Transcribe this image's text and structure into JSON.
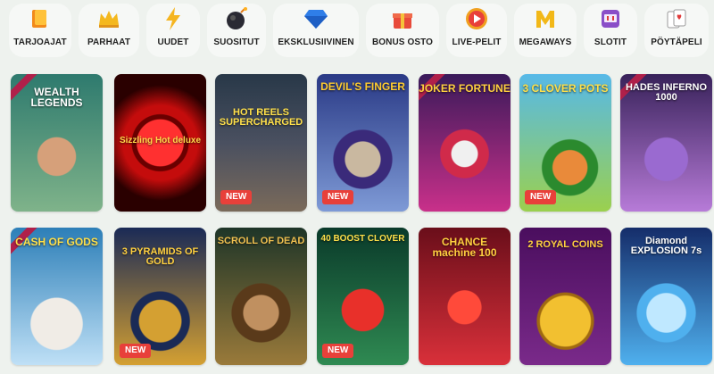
{
  "categories": [
    {
      "label": "TARJOAJAT",
      "icon": "book-icon"
    },
    {
      "label": "PARHAAT",
      "icon": "crown-icon"
    },
    {
      "label": "UUDET",
      "icon": "lightning-icon"
    },
    {
      "label": "SUOSITUT",
      "icon": "bomb-icon"
    },
    {
      "label": "EKSKLUSIIVINEN",
      "icon": "gem-icon"
    },
    {
      "label": "BONUS OSTO",
      "icon": "gift-icon"
    },
    {
      "label": "LIVE-PELIT",
      "icon": "play-icon"
    },
    {
      "label": "MEGAWAYS",
      "icon": "megaways-m-icon"
    },
    {
      "label": "SLOTIT",
      "icon": "slot-machine-icon"
    },
    {
      "label": "PÖYTÄPELI",
      "icon": "cards-icon"
    }
  ],
  "badges": {
    "new": "NEW"
  },
  "games": [
    {
      "title": "WEALTH LEGENDS",
      "new": false,
      "colors": [
        "#2e7a6e",
        "#7fb38a"
      ]
    },
    {
      "title": "Sizzling Hot deluxe",
      "new": false,
      "colors": [
        "#3a0000",
        "#c40c0c"
      ]
    },
    {
      "title": "HOT REELS SUPERCHARGED",
      "new": true,
      "colors": [
        "#283848",
        "#7a6a5a"
      ]
    },
    {
      "title": "DEVIL'S FINGER",
      "new": true,
      "colors": [
        "#2a3a86",
        "#7e9ad6"
      ]
    },
    {
      "title": "JOKER FORTUNE",
      "new": false,
      "colors": [
        "#3a1a5a",
        "#c9308a"
      ]
    },
    {
      "title": "3 CLOVER POTS",
      "new": true,
      "colors": [
        "#2b8a2e",
        "#9bd04e"
      ]
    },
    {
      "title": "HADES INFERNO 1000",
      "new": false,
      "colors": [
        "#38225a",
        "#b77bd8"
      ]
    },
    {
      "title": "CASH OF GODS",
      "new": false,
      "colors": [
        "#2d7fb8",
        "#bfe0f6"
      ]
    },
    {
      "title": "3 PYRAMIDS OF GOLD",
      "new": true,
      "colors": [
        "#1a2a56",
        "#d4a032"
      ]
    },
    {
      "title": "SCROLL OF DEAD",
      "new": false,
      "colors": [
        "#1e3528",
        "#9a7a3a"
      ]
    },
    {
      "title": "40 BOOST CLOVER",
      "new": true,
      "colors": [
        "#0a3a2a",
        "#2f8a52"
      ]
    },
    {
      "title": "CHANCE machine 100",
      "new": false,
      "colors": [
        "#6a0e1a",
        "#d9303a"
      ]
    },
    {
      "title": "2 ROYAL COINS",
      "new": false,
      "colors": [
        "#4a0e5e",
        "#e0a428"
      ]
    },
    {
      "title": "Diamond EXPLOSION 7s",
      "new": false,
      "colors": [
        "#152d6a",
        "#4fb0ee"
      ]
    }
  ]
}
